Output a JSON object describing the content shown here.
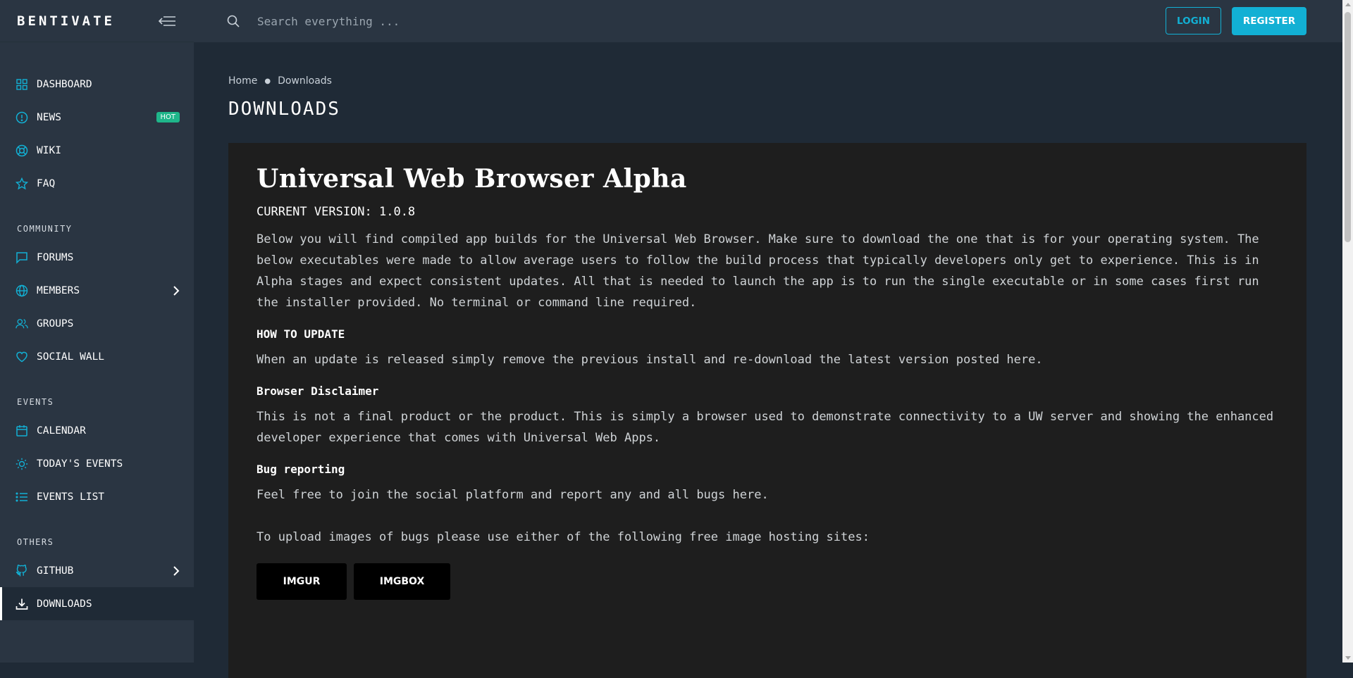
{
  "brand": "BENTIVATE",
  "search": {
    "placeholder": "Search everything ..."
  },
  "header": {
    "login_label": "LOGIN",
    "register_label": "REGISTER"
  },
  "sidebar": {
    "items_main": [
      {
        "label": "DASHBOARD",
        "icon": "grid-icon"
      },
      {
        "label": "NEWS",
        "icon": "alert-circle-icon",
        "badge": "HOT"
      },
      {
        "label": "WIKI",
        "icon": "lifebuoy-icon"
      },
      {
        "label": "FAQ",
        "icon": "star-icon"
      }
    ],
    "sections": [
      {
        "title": "COMMUNITY",
        "items": [
          {
            "label": "FORUMS",
            "icon": "chat-icon"
          },
          {
            "label": "MEMBERS",
            "icon": "globe-icon",
            "has_arrow": true
          },
          {
            "label": "GROUPS",
            "icon": "users-icon"
          },
          {
            "label": "SOCIAL WALL",
            "icon": "heart-icon"
          }
        ]
      },
      {
        "title": "EVENTS",
        "items": [
          {
            "label": "CALENDAR",
            "icon": "calendar-icon"
          },
          {
            "label": "TODAY'S EVENTS",
            "icon": "sun-icon"
          },
          {
            "label": "EVENTS LIST",
            "icon": "list-icon"
          }
        ]
      },
      {
        "title": "OTHERS",
        "items": [
          {
            "label": "GITHUB",
            "icon": "github-icon",
            "has_arrow": true
          },
          {
            "label": "DOWNLOADS",
            "icon": "download-icon",
            "active": true
          }
        ]
      }
    ]
  },
  "breadcrumb": {
    "home": "Home",
    "current": "Downloads"
  },
  "page_title": "DOWNLOADS",
  "content": {
    "title": "Universal Web Browser Alpha",
    "version": "CURRENT VERSION: 1.0.8",
    "intro": "Below you will find compiled app builds for the Universal Web Browser. Make sure to download the one that is for your operating system. The below executables were made to allow average users to follow the build process that typically developers only get to experience. This is in Alpha stages and expect consistent updates. All that is needed to launch the app is to run the single executable or in some cases first run the installer provided. No terminal or command line required.",
    "update_heading": "HOW TO UPDATE",
    "update_text": "When an update is released simply remove the previous install and re-download the latest version posted here.",
    "disclaimer_heading": "Browser Disclaimer",
    "disclaimer_text": "This is not a final product or the product. This is simply a browser used to demonstrate connectivity to a UW server and showing the enhanced developer experience that comes with Universal Web Apps.",
    "bug_heading": "Bug reporting",
    "bug_text": "Feel free to join the social platform and report any and all bugs here.",
    "upload_text": "To upload images of bugs please use either of the following free image hosting sites:",
    "buttons": [
      "IMGUR",
      "IMGBOX"
    ]
  },
  "colors": {
    "accent": "#12b0d4",
    "badge": "#1fb68a",
    "sidebar": "#2a3542",
    "card": "#1e1e1e"
  }
}
